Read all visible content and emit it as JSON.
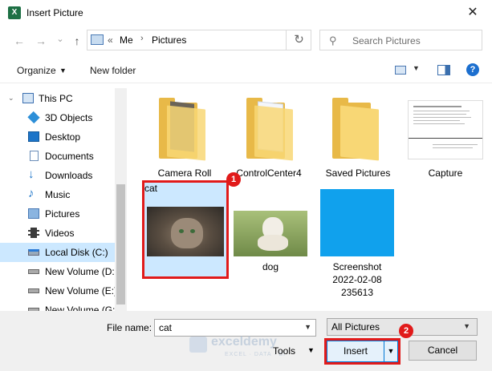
{
  "window": {
    "title": "Insert Picture",
    "app_icon": "X",
    "close_glyph": "✕"
  },
  "nav": {
    "back_glyph": "←",
    "forward_glyph": "→",
    "history_glyph": "⌄",
    "up_glyph": "↑",
    "address": {
      "overflow": "«",
      "parts": [
        "Me",
        "Pictures"
      ],
      "separator": "›"
    },
    "refresh_glyph": "↻",
    "search_placeholder": "Search Pictures"
  },
  "toolbar": {
    "organize_label": "Organize",
    "new_folder_label": "New folder",
    "help_glyph": "?"
  },
  "sidebar": {
    "items": [
      {
        "label": "This PC",
        "icon": "pc-icon"
      },
      {
        "label": "3D Objects",
        "icon": "cube-icon"
      },
      {
        "label": "Desktop",
        "icon": "desktop-icon"
      },
      {
        "label": "Documents",
        "icon": "documents-icon"
      },
      {
        "label": "Downloads",
        "icon": "download-icon"
      },
      {
        "label": "Music",
        "icon": "music-icon"
      },
      {
        "label": "Pictures",
        "icon": "pictures-icon"
      },
      {
        "label": "Videos",
        "icon": "videos-icon"
      },
      {
        "label": "Local Disk (C:)",
        "icon": "disk-icon",
        "selected": true
      },
      {
        "label": "New Volume (D:",
        "icon": "drive-icon"
      },
      {
        "label": "New Volume (E:)",
        "icon": "drive-icon"
      },
      {
        "label": "New Volume (G:",
        "icon": "drive-icon"
      }
    ]
  },
  "files": [
    {
      "name": "Camera Roll",
      "type": "folder"
    },
    {
      "name": "ControlCenter4",
      "type": "folder"
    },
    {
      "name": "Saved Pictures",
      "type": "folder"
    },
    {
      "name": "Capture",
      "type": "image"
    },
    {
      "name": "cat",
      "type": "image",
      "selected": true
    },
    {
      "name": "dog",
      "type": "image"
    },
    {
      "name": "Screenshot",
      "name_line2": "2022-02-08",
      "name_line3": "235613",
      "type": "image"
    }
  ],
  "callouts": {
    "step1": "1",
    "step2": "2"
  },
  "footer": {
    "file_name_label": "File name:",
    "file_name_value": "cat",
    "file_type_value": "All Pictures",
    "tools_label": "Tools",
    "insert_label": "Insert",
    "cancel_label": "Cancel"
  },
  "watermark": {
    "main": "exceldemy",
    "sub": "EXCEL · DATA · BI"
  },
  "colors": {
    "accent": "#0078d7",
    "highlight": "#e11a1a",
    "selection": "#cce8ff",
    "folder": "#f8d775"
  }
}
